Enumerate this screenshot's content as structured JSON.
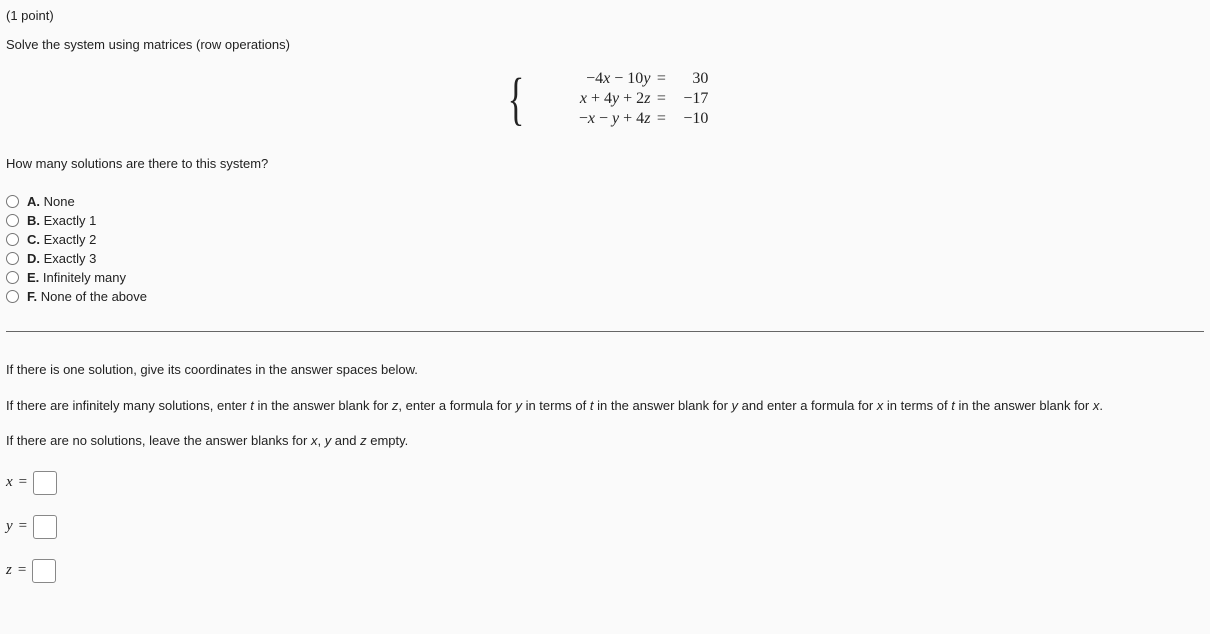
{
  "points": "(1 point)",
  "prompt": "Solve the system using matrices (row operations)",
  "system": {
    "rows": [
      {
        "lhs": "−4x − 10y",
        "rhs": "30"
      },
      {
        "lhs": "x + 4y + 2z",
        "rhs": "−17"
      },
      {
        "lhs": "−x − y + 4z",
        "rhs": "−10"
      }
    ]
  },
  "question2": "How many solutions are there to this system?",
  "choices": [
    {
      "letter": "A.",
      "text": "None"
    },
    {
      "letter": "B.",
      "text": "Exactly 1"
    },
    {
      "letter": "C.",
      "text": "Exactly 2"
    },
    {
      "letter": "D.",
      "text": "Exactly 3"
    },
    {
      "letter": "E.",
      "text": "Infinitely many"
    },
    {
      "letter": "F.",
      "text": "None of the above"
    }
  ],
  "instructions": {
    "one": "If there is one solution, give its coordinates in the answer spaces below.",
    "inf_pre": "If there are infinitely many solutions, enter ",
    "inf_t": "t",
    "inf_mid1": " in the answer blank for ",
    "inf_z": "z",
    "inf_mid2": ", enter a formula for ",
    "inf_y": "y",
    "inf_mid3": " in terms of ",
    "inf_mid4": " in the answer blank for ",
    "inf_mid5": " and enter a formula for ",
    "inf_x": "x",
    "inf_mid6": " in terms of ",
    "inf_mid7": " in the answer blank for ",
    "inf_end": ".",
    "none_pre": "If there are no solutions, leave the answer blanks for ",
    "none_mid1": ", ",
    "none_mid2": " and ",
    "none_end": " empty."
  },
  "answers": {
    "x_label": "x",
    "y_label": "y",
    "z_label": "z",
    "eq": "="
  }
}
